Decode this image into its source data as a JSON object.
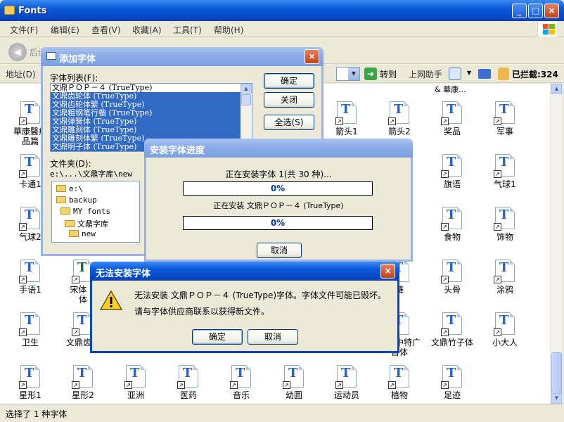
{
  "window": {
    "title": "Fonts",
    "min": "_",
    "max": "□",
    "close": "×"
  },
  "menubar": {
    "items": [
      "文件(F)",
      "编辑(E)",
      "查看(V)",
      "收藏(A)",
      "工具(T)",
      "帮助(H)"
    ]
  },
  "toolbar": {
    "back_label": "后退",
    "back_icon": "back-arrow-icon"
  },
  "addressbar": {
    "label": "地址(D)",
    "go_label": "转到",
    "assistant_label": "上网助手",
    "blocked_label": "已拦截:324",
    "partial_text": "& 華康..."
  },
  "files": [
    {
      "label": "華康醫療\n品篇",
      "col": 0,
      "row": 0
    },
    {
      "label": "箭头1",
      "col": 6,
      "row": 0
    },
    {
      "label": "箭头2",
      "col": 7,
      "row": 0
    },
    {
      "label": "奖品",
      "col": 8,
      "row": 0
    },
    {
      "label": "军事",
      "col": 9,
      "row": 0
    },
    {
      "label": "卡通1",
      "col": 0,
      "row": 1
    },
    {
      "label": "旗语",
      "col": 8,
      "row": 1
    },
    {
      "label": "气球1",
      "col": 9,
      "row": 1
    },
    {
      "label": "气球2",
      "col": 0,
      "row": 2
    },
    {
      "label": "食物",
      "col": 8,
      "row": 2
    },
    {
      "label": "饰物",
      "col": 9,
      "row": 2
    },
    {
      "label": "手语1",
      "col": 0,
      "row": 3
    },
    {
      "label": "宋体 &\n体",
      "col": 1,
      "row": 3,
      "tt": true
    },
    {
      "label": "舞",
      "col": 7,
      "row": 3
    },
    {
      "label": "头骨",
      "col": 8,
      "row": 3
    },
    {
      "label": "涂鸦",
      "col": 9,
      "row": 3
    },
    {
      "label": "卫生",
      "col": 0,
      "row": 4
    },
    {
      "label": "文鼎齿轮",
      "col": 1,
      "row": 4
    },
    {
      "label": "文鼎中特广\n告体",
      "col": 7,
      "row": 4
    },
    {
      "label": "文鼎竹子体",
      "col": 8,
      "row": 4
    },
    {
      "label": "小大人",
      "col": 9,
      "row": 4
    },
    {
      "label": "星形1",
      "col": 0,
      "row": 5
    },
    {
      "label": "星形2",
      "col": 1,
      "row": 5
    },
    {
      "label": "亚洲",
      "col": 2,
      "row": 5
    },
    {
      "label": "医药",
      "col": 3,
      "row": 5
    },
    {
      "label": "音乐",
      "col": 4,
      "row": 5
    },
    {
      "label": "幼圆",
      "col": 5,
      "row": 5
    },
    {
      "label": "运动员",
      "col": 6,
      "row": 5
    },
    {
      "label": "植物",
      "col": 7,
      "row": 5
    },
    {
      "label": "足迹",
      "col": 8,
      "row": 5
    }
  ],
  "status": {
    "text": "选择了 1 种字体"
  },
  "add_font": {
    "title": "添加字体",
    "close": "×",
    "list_label": "字体列表(F):",
    "fonts": [
      {
        "name": "文鼎ＰＯＰ－４ (TrueType)",
        "selected": false
      },
      {
        "name": "文鼎齿轮体 (TrueType)",
        "selected": true
      },
      {
        "name": "文鼎齿轮体繁 (TrueType)",
        "selected": true
      },
      {
        "name": "文鼎粗钢笔行楷 (TrueType)",
        "selected": true
      },
      {
        "name": "文鼎弹簧体 (TrueType)",
        "selected": true
      },
      {
        "name": "文鼎雕刻体 (TrueType)",
        "selected": true
      },
      {
        "name": "文鼎雕刻体繁 (TrueType)",
        "selected": true
      },
      {
        "name": "文鼎明子体 (TrueType)",
        "selected": true
      }
    ],
    "ok": "确定",
    "close_btn": "关闭",
    "select_all": "全选(S)",
    "folder_label": "文件夹(D):",
    "folder_path": "e:\\...\\文鼎字库\\new",
    "tree": [
      "e:\\",
      "backup",
      "MY fonts",
      "文鼎字库",
      "new"
    ]
  },
  "progress": {
    "title": "安装字体进度",
    "line1": "正在安装字体 1(共 30 种)...",
    "bar1": "0%",
    "bar1_value": 0,
    "line2": "正在安装 文鼎ＰＯＰ－４ (TrueType)",
    "bar2": "0%",
    "bar2_value": 0,
    "cancel": "取消"
  },
  "error": {
    "title": "无法安装字体",
    "close": "×",
    "message1": "无法安装 文鼎ＰＯＰ－４ (TrueType)字体。字体文件可能已毁坏。",
    "message2": "请与字体供应商联系以获得新文件。",
    "ok": "确定",
    "cancel": "取消",
    "icon": "warning-icon"
  }
}
